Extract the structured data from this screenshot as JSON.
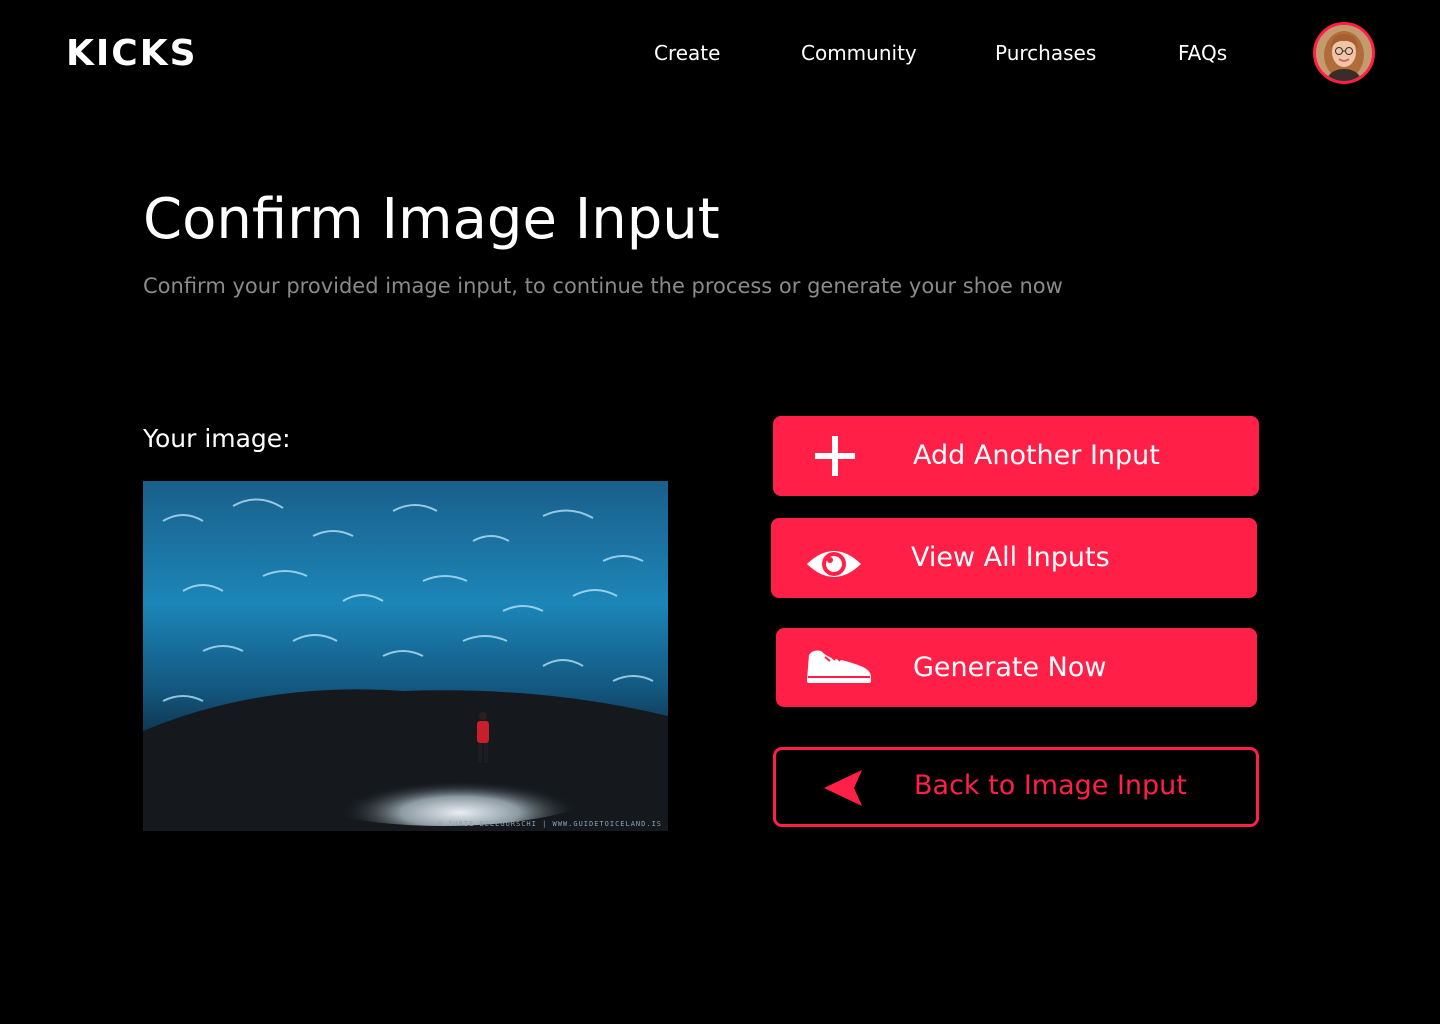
{
  "brand": {
    "logo": "KICKS",
    "accent_color": "#ff1f47"
  },
  "nav": {
    "items": [
      {
        "label": "Create"
      },
      {
        "label": "Community"
      },
      {
        "label": "Purchases"
      },
      {
        "label": "FAQs"
      }
    ],
    "avatar_icon": "user-avatar"
  },
  "main": {
    "title": "Confirm Image Input",
    "subtitle": "Confirm your provided image input, to continue the process or generate your shoe now",
    "image_label": "Your image:",
    "image_credit": "© IURIE BELEGURSCHI | WWW.GUIDETOICELAND.IS"
  },
  "actions": {
    "add": {
      "label": "Add Another Input",
      "icon": "plus-icon"
    },
    "view": {
      "label": "View All Inputs",
      "icon": "eye-icon"
    },
    "generate": {
      "label": "Generate Now",
      "icon": "shoe-icon"
    },
    "back": {
      "label": "Back to Image Input",
      "icon": "arrow-left-icon"
    }
  }
}
